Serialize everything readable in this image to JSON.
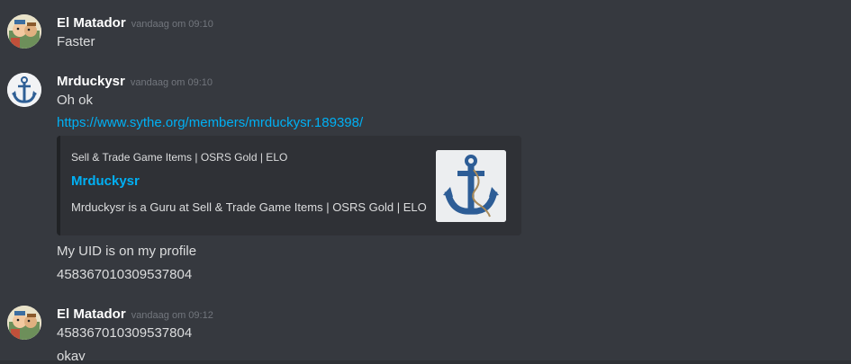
{
  "messages": [
    {
      "username": "El Matador",
      "timestamp": "vandaag om 09:10",
      "avatar_icon": "cartoon-avatar-icon",
      "lines": [
        "Faster"
      ]
    },
    {
      "username": "Mrduckysr",
      "timestamp": "vandaag om 09:10",
      "avatar_icon": "anchor-avatar-icon",
      "lines": [
        "Oh ok"
      ],
      "link": "https://www.sythe.org/members/mrduckysr.189398/",
      "embed": {
        "provider": "Sell & Trade Game Items | OSRS Gold | ELO",
        "title": "Mrduckysr",
        "description": "Mrduckysr is a Guru at Sell & Trade Game Items | OSRS Gold | ELO",
        "thumbnail_icon": "anchor-thumbnail-icon"
      },
      "after_lines": [
        "My UID is on my profile",
        "458367010309537804"
      ]
    },
    {
      "username": "El Matador",
      "timestamp": "vandaag om 09:12",
      "avatar_icon": "cartoon-avatar-icon",
      "lines": [
        "458367010309537804",
        "okay"
      ]
    }
  ],
  "colors": {
    "background": "#36393f",
    "username": "#ffffff",
    "timestamp": "#72767d",
    "text": "#dcddde",
    "link": "#00b0f4",
    "embed_bg": "#2f3136"
  }
}
